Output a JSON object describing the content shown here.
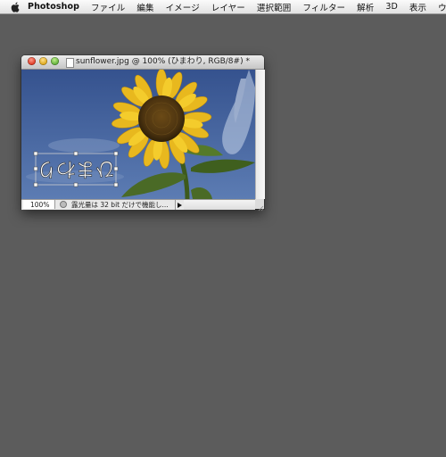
{
  "menubar": {
    "app_name": "Photoshop",
    "items": [
      "ファイル",
      "編集",
      "イメージ",
      "レイヤー",
      "選択範囲",
      "フィルター",
      "解析",
      "3D",
      "表示",
      "ウィ"
    ]
  },
  "document": {
    "title": "sunflower.jpg @ 100% (ひまわり, RGB/8#) *",
    "zoom": "100%",
    "status": "露光量は 32 bit だけで機能し..."
  },
  "canvas": {
    "text_layer": "ひまわり"
  },
  "colors": {
    "desktop": "#5c5c5c",
    "sky": "#3e5f9a",
    "petal": "#e8b81e"
  },
  "icons": {
    "apple": "apple-icon",
    "close": "close-icon",
    "minimize": "minimize-icon",
    "zoom": "zoom-icon",
    "document": "document-icon",
    "status_menu": "triangle-right-icon"
  }
}
